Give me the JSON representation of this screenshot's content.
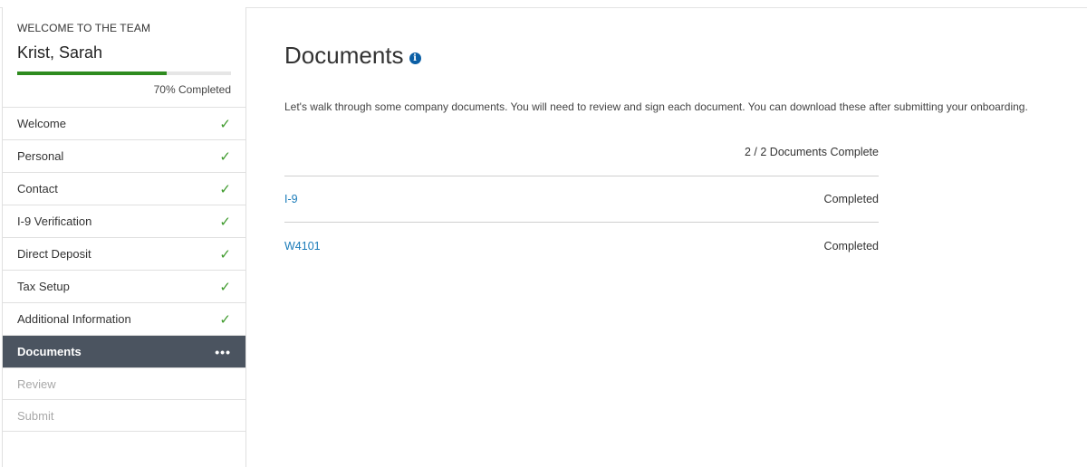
{
  "sidebar": {
    "welcome_label": "WELCOME TO THE TEAM",
    "user_name": "Krist, Sarah",
    "progress": {
      "percent": 70,
      "label": "70% Completed",
      "color": "#2e8b1f"
    },
    "steps": [
      {
        "label": "Welcome",
        "status": "done",
        "icon": "check-icon"
      },
      {
        "label": "Personal",
        "status": "done",
        "icon": "check-icon"
      },
      {
        "label": "Contact",
        "status": "done",
        "icon": "check-icon"
      },
      {
        "label": "I-9 Verification",
        "status": "done",
        "icon": "check-icon"
      },
      {
        "label": "Direct Deposit",
        "status": "done",
        "icon": "check-icon"
      },
      {
        "label": "Tax Setup",
        "status": "done",
        "icon": "check-icon"
      },
      {
        "label": "Additional Information",
        "status": "done",
        "icon": "check-icon"
      },
      {
        "label": "Documents",
        "status": "active",
        "icon": "more-dots-icon"
      },
      {
        "label": "Review",
        "status": "pending"
      },
      {
        "label": "Submit",
        "status": "pending"
      }
    ]
  },
  "main": {
    "title": "Documents",
    "info_icon": "info-icon",
    "intro": "Let's walk through some company documents. You will need to review and sign each document. You can download these after submitting your onboarding.",
    "doc_count": "2 / 2 Documents Complete",
    "documents": [
      {
        "name": "I-9",
        "status": "Completed"
      },
      {
        "name": "W4101",
        "status": "Completed"
      }
    ]
  },
  "colors": {
    "active_step_bg": "#4b5460",
    "check": "#3e9a2c",
    "link": "#1a7bb9",
    "info_icon": "#0b5fa5"
  }
}
